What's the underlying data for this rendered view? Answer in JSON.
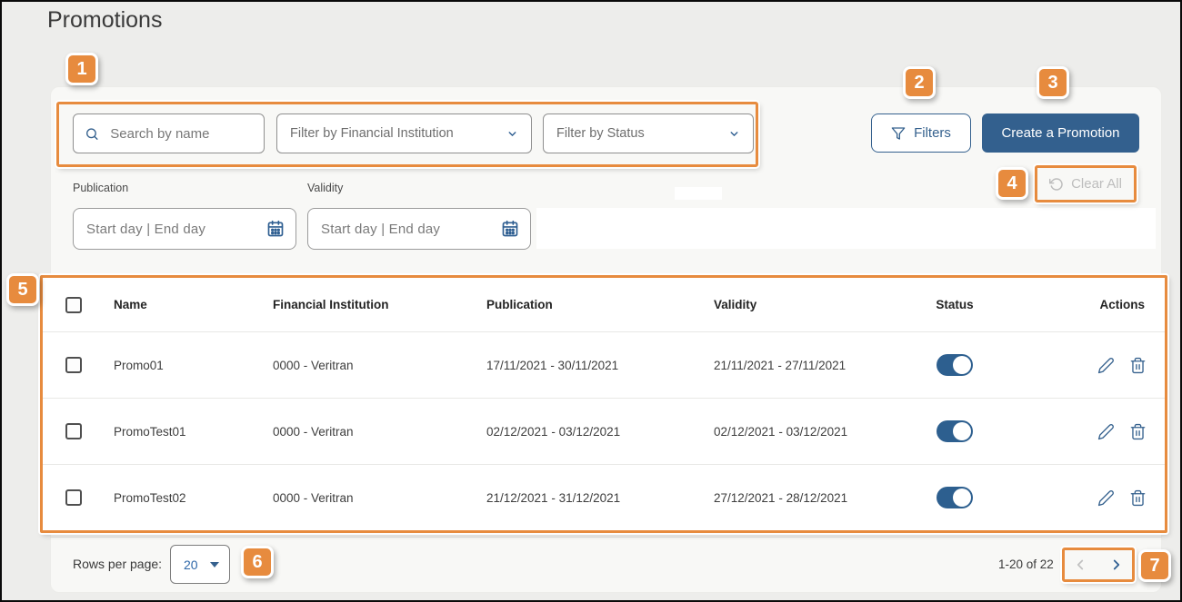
{
  "page": {
    "title": "Promotions"
  },
  "callouts": [
    "1",
    "2",
    "3",
    "4",
    "5",
    "6",
    "7"
  ],
  "toolbar": {
    "search_placeholder": "Search by name",
    "financial_institution_filter_label": "Filter by Financial Institution",
    "status_filter_label": "Filter by Status",
    "filters_button_label": "Filters",
    "create_button_label": "Create a Promotion",
    "clear_all_label": "Clear All"
  },
  "date_filters": {
    "publication_label": "Publication",
    "validity_label": "Validity",
    "range_placeholder": "Start day  |  End day"
  },
  "table": {
    "headers": [
      "Name",
      "Financial Institution",
      "Publication",
      "Validity",
      "Status",
      "Actions"
    ],
    "rows": [
      {
        "name": "Promo01",
        "financial_institution": "0000 - Veritran",
        "publication": "17/11/2021 - 30/11/2021",
        "validity": "21/11/2021 - 27/11/2021",
        "status": "on"
      },
      {
        "name": "PromoTest01",
        "financial_institution": "0000 - Veritran",
        "publication": "02/12/2021 - 03/12/2021",
        "validity": "02/12/2021 - 03/12/2021",
        "status": "on"
      },
      {
        "name": "PromoTest02",
        "financial_institution": "0000 - Veritran",
        "publication": "21/12/2021 - 31/12/2021",
        "validity": "27/12/2021 - 28/12/2021",
        "status": "on"
      }
    ]
  },
  "footer": {
    "rows_per_page_label": "Rows per page:",
    "rows_per_page_value": "20",
    "range_text": "1-20 of 22"
  },
  "colors": {
    "accent_orange": "#E78B3E",
    "primary_blue": "#33608E",
    "toggle_on": "#2D5F8F",
    "disabled_gray": "#BDBDBD"
  }
}
